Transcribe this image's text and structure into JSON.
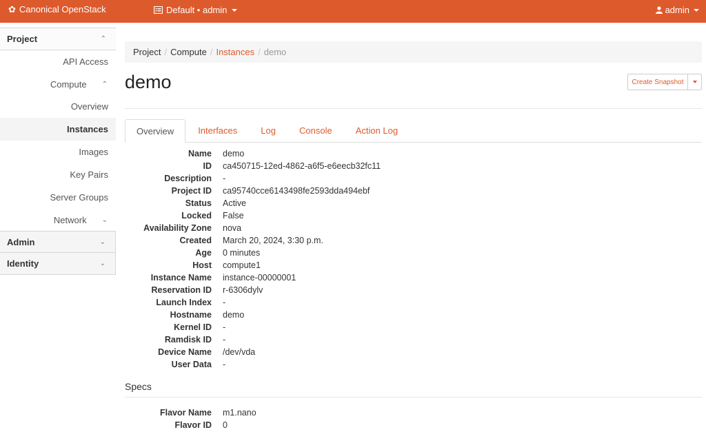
{
  "topbar": {
    "brand": "Canonical OpenStack",
    "brand_icon": "canonical-circle-icon",
    "project_label": "Default • admin",
    "user_label": "admin",
    "accent": "#dd5a2c"
  },
  "sidebar": {
    "project_label": "Project",
    "api_access": "API Access",
    "compute_label": "Compute",
    "compute_items": [
      "Overview",
      "Instances",
      "Images",
      "Key Pairs",
      "Server Groups"
    ],
    "network_label": "Network",
    "admin_label": "Admin",
    "identity_label": "Identity"
  },
  "breadcrumb": [
    "Project",
    "Compute",
    "Instances",
    "demo"
  ],
  "page": {
    "title": "demo",
    "create_snapshot": "Create Snapshot"
  },
  "tabs": [
    "Overview",
    "Interfaces",
    "Log",
    "Console",
    "Action Log"
  ],
  "details": [
    {
      "label": "Name",
      "value": "demo"
    },
    {
      "label": "ID",
      "value": "ca450715-12ed-4862-a6f5-e6eecb32fc11"
    },
    {
      "label": "Description",
      "value": "-"
    },
    {
      "label": "Project ID",
      "value": "ca95740cce6143498fe2593dda494ebf"
    },
    {
      "label": "Status",
      "value": "Active"
    },
    {
      "label": "Locked",
      "value": "False"
    },
    {
      "label": "Availability Zone",
      "value": "nova"
    },
    {
      "label": "Created",
      "value": "March 20, 2024, 3:30 p.m."
    },
    {
      "label": "Age",
      "value": "0 minutes"
    },
    {
      "label": "Host",
      "value": "compute1"
    },
    {
      "label": "Instance Name",
      "value": "instance-00000001"
    },
    {
      "label": "Reservation ID",
      "value": "r-6306dylv"
    },
    {
      "label": "Launch Index",
      "value": "-"
    },
    {
      "label": "Hostname",
      "value": "demo"
    },
    {
      "label": "Kernel ID",
      "value": "-"
    },
    {
      "label": "Ramdisk ID",
      "value": "-"
    },
    {
      "label": "Device Name",
      "value": "/dev/vda"
    },
    {
      "label": "User Data",
      "value": "-"
    }
  ],
  "specs": {
    "title": "Specs",
    "rows": [
      {
        "label": "Flavor Name",
        "value": "m1.nano"
      },
      {
        "label": "Flavor ID",
        "value": "0"
      }
    ]
  }
}
